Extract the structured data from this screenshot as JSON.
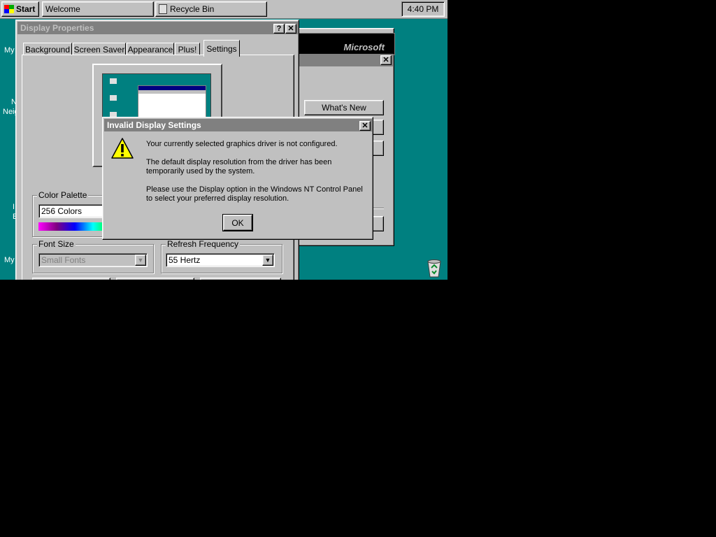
{
  "taskbar": {
    "start_label": "Start",
    "tasks": [
      {
        "label": "Welcome"
      },
      {
        "label": "Recycle Bin"
      }
    ],
    "clock": "4:40 PM"
  },
  "desktop": {
    "fragments": [
      "My",
      "N",
      "Neig",
      "I",
      "E",
      "My"
    ]
  },
  "display_props": {
    "title": "Display Properties",
    "help_glyph": "?",
    "close_glyph": "✕",
    "tabs": [
      "Background",
      "Screen Saver",
      "Appearance",
      "Plus!",
      "Settings"
    ],
    "active_tab": "Settings",
    "color_palette": {
      "label": "Color Palette",
      "value": "256 Colors"
    },
    "font_size": {
      "label": "Font Size",
      "value": "Small Fonts"
    },
    "refresh": {
      "label": "Refresh Frequency",
      "value": "55 Hertz"
    }
  },
  "welcome": {
    "brand": "Microsoft",
    "close_glyph": "✕",
    "whats_new_label": "What's New"
  },
  "dialog": {
    "title": "Invalid Display Settings",
    "close_glyph": "✕",
    "line1": "Your currently selected graphics driver is not configured.",
    "line2": "The default display resolution from the driver has been temporarily used by the system.",
    "line3": "Please use the Display option in the Windows NT Control Panel to select your preferred display resolution.",
    "ok_label": "OK"
  },
  "colors": {
    "desktop": "#008080",
    "window_face": "#c0c0c0",
    "title_inactive": "#808080",
    "dialog_title": "#808080"
  }
}
